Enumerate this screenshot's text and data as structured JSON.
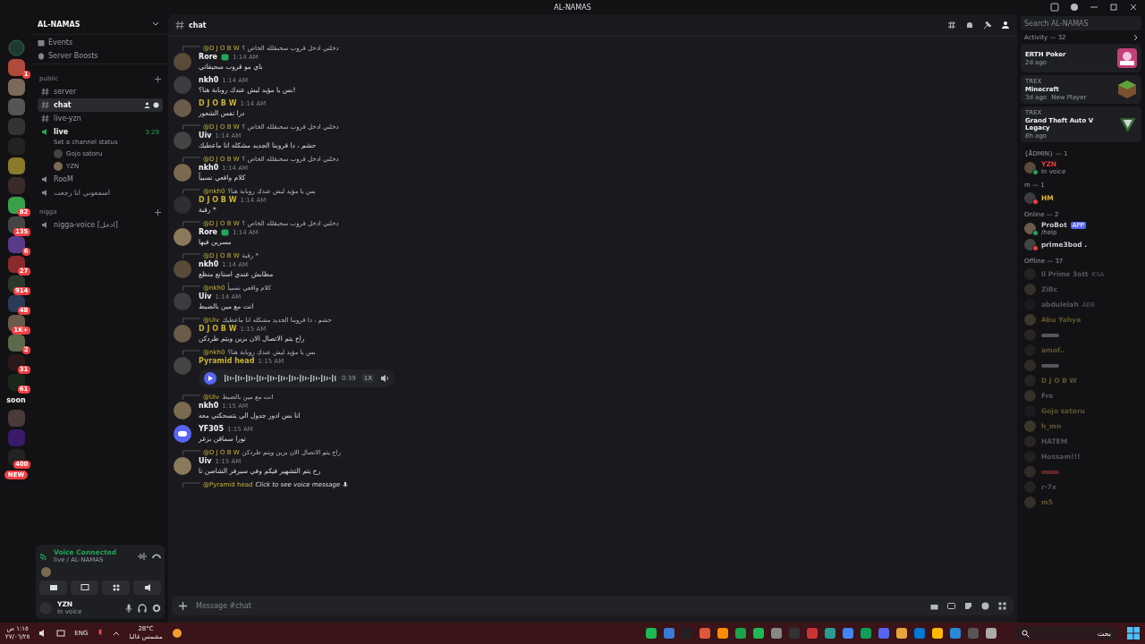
{
  "window": {
    "title": "AL-NAMAS"
  },
  "servers": [
    {
      "kind": "home"
    },
    {
      "kind": "server",
      "badge": "1"
    },
    {
      "kind": "server"
    },
    {
      "kind": "server"
    },
    {
      "kind": "server"
    },
    {
      "kind": "server"
    },
    {
      "kind": "server"
    },
    {
      "kind": "server"
    },
    {
      "kind": "server",
      "badge": "82"
    },
    {
      "kind": "server",
      "badge": "135"
    },
    {
      "kind": "server",
      "badge": "6"
    },
    {
      "kind": "server",
      "badge": "27"
    },
    {
      "kind": "server",
      "badge": "914"
    },
    {
      "kind": "server",
      "badge": "48"
    },
    {
      "kind": "server",
      "badge": "1K+"
    },
    {
      "kind": "server",
      "badge": "2"
    },
    {
      "kind": "server",
      "badge": "31"
    },
    {
      "kind": "server",
      "badge": "61"
    },
    {
      "kind": "label",
      "text": "soon"
    },
    {
      "kind": "server"
    },
    {
      "kind": "server"
    },
    {
      "kind": "server",
      "badge": "400"
    },
    {
      "kind": "new",
      "text": "NEW"
    }
  ],
  "sidebar": {
    "server_name": "AL-NAMAS",
    "links": [
      {
        "kind": "events",
        "label": "Events"
      },
      {
        "kind": "boosts",
        "label": "Server Boosts"
      }
    ],
    "categories": [
      {
        "name": "public",
        "channels": [
          {
            "kind": "text",
            "name": "server",
            "selected": false
          },
          {
            "kind": "text",
            "name": "chat",
            "selected": true
          },
          {
            "kind": "text",
            "name": "live-yzn",
            "selected": false
          },
          {
            "kind": "voice",
            "name": "live",
            "selected": false,
            "timer": "3:29",
            "status": "Set a channel status",
            "members": [
              "Gojo satoru",
              "YZN"
            ]
          },
          {
            "kind": "voice",
            "name": "RooM",
            "selected": false
          },
          {
            "kind": "voice",
            "name": "اسمعوني انا رجعت",
            "selected": false
          }
        ]
      },
      {
        "name": "nigga",
        "channels": [
          {
            "kind": "voice",
            "name": "nigga-voice [ادخل]",
            "selected": false
          }
        ]
      }
    ]
  },
  "voice": {
    "title": "Voice Connected",
    "subtitle": "live / AL-NAMAS"
  },
  "user": {
    "name": "YZN",
    "status": "In voice"
  },
  "chat": {
    "channel": "chat",
    "search_placeholder": "Search AL-NAMAS",
    "composer_placeholder": "Message #chat",
    "messages": [
      {
        "kind": "text",
        "reply_to": "@D J O B W",
        "reply_text": "دخلني ادخل قروب سحبقلله الخاص ؟",
        "author": "Rore",
        "color": "#f2f3f5",
        "verified": true,
        "time": "1:14 AM",
        "text": "باي مو قروب سحيقاتي"
      },
      {
        "kind": "text",
        "author": "nkh0",
        "color": "#f2f3f5",
        "verified": false,
        "time": "1:14 AM",
        "text": "بس يا مؤيد ليش عندك روبابة هنا؟!"
      },
      {
        "kind": "text",
        "author": "D J O B W",
        "color": "#c9b037",
        "verified": false,
        "time": "1:14 AM",
        "text": "درا نفس الشعور"
      },
      {
        "kind": "text",
        "reply_to": "@D J O B W",
        "reply_text": "دخلني ادخل قروب سحبقلله الخاص ؟",
        "author": "Uiv",
        "color": "#f2f3f5",
        "verified": false,
        "time": "1:14 AM",
        "text": "حشم ، دا قروبنا الجديد مشكله انا ماعطيك"
      },
      {
        "kind": "text",
        "reply_to": "@D J O B W",
        "reply_text": "دخلني ادخل قروب سحبقلله الخاص ؟",
        "author": "nkh0",
        "color": "#f2f3f5",
        "verified": false,
        "time": "1:14 AM",
        "text": "كلام واقعي نسبياً"
      },
      {
        "kind": "text",
        "reply_to": "@nkh0",
        "reply_text": "بس يا مؤيد ليش عندك روبابة هنا؟",
        "author": "D J O B W",
        "color": "#c9b037",
        "verified": false,
        "time": "1:14 AM",
        "text": "رقبة *"
      },
      {
        "kind": "text",
        "reply_to": "@D J O B W",
        "reply_text": "دخلني ادخل قروب سحبقلله الخاص ؟",
        "author": "Rore",
        "color": "#f2f3f5",
        "verified": true,
        "time": "1:14 AM",
        "text": "مسرين فيها"
      },
      {
        "kind": "text",
        "reply_to": "@D J O B W",
        "reply_text": "رقبة *",
        "author": "nkh0",
        "color": "#f2f3f5",
        "verified": false,
        "time": "1:14 AM",
        "text": "مطابش عندي اسنانع منظع"
      },
      {
        "kind": "text",
        "reply_to": "@nkh0",
        "reply_text": "كلام واقعي نسبياً",
        "author": "Uiv",
        "color": "#f2f3f5",
        "verified": false,
        "time": "1:14 AM",
        "text": "انت مع مين بالضبط"
      },
      {
        "kind": "text",
        "reply_to": "@Uiv",
        "reply_text": "حشم ، دا قروبنا الجديد مشكله انا ماعطيك",
        "author": "D J O B W",
        "color": "#c9b037",
        "verified": false,
        "time": "1:15 AM",
        "text": "راح يتم الاتصال الان بزين ويتم طردكن"
      },
      {
        "kind": "voice",
        "reply_to": "@nkh0",
        "reply_text": "بس يا مؤيد ليش عندك روبابة هنا؟",
        "author": "Pyramid head",
        "color": "#c9b037",
        "verified": false,
        "time": "1:15 AM",
        "duration": "0:39",
        "speed": "1X"
      },
      {
        "kind": "text",
        "reply_to": "@Uiv",
        "reply_text": "انت مع مين بالضبط",
        "author": "nkh0",
        "color": "#f2f3f5",
        "verified": false,
        "time": "1:15 AM",
        "text": "انا بس ادور جدول الي يتسحكني معه"
      },
      {
        "kind": "text",
        "author": "YF305",
        "color": "#f2f3f5",
        "verified": false,
        "time": "1:15 AM",
        "text": "نورا سماقن بزغر"
      },
      {
        "kind": "text",
        "reply_to": "@D J O B W",
        "reply_text": "راح يتم الاتصال الان بزين ويتم طردكن",
        "author": "Uiv",
        "color": "#f2f3f5",
        "verified": false,
        "time": "1:15 AM",
        "text": "رح يتم التشهير فيكم وفي سيرفر الشاصن نا"
      },
      {
        "kind": "cut",
        "reply_to": "@Pyramid head",
        "reply_text": "Click to see voice message"
      }
    ]
  },
  "members": {
    "activity_title": "Activity — 32",
    "cards": [
      {
        "kind": "poker",
        "game": "ERTH Poker",
        "meta": "2d ago"
      },
      {
        "kind": "minecraft",
        "user": "TREX",
        "game": "Minecraft",
        "meta": "3d ago",
        "tag": "New Player"
      },
      {
        "kind": "gta",
        "user": "TREX",
        "game": "Grand Theft Auto V Legacy",
        "meta": "8h ago"
      }
    ],
    "groups": [
      {
        "title": "{ÅDMIN} — 1",
        "kind": "online",
        "members": [
          {
            "name": "YZN",
            "color": "#e03a3a",
            "dnd": false,
            "status": "In voice"
          }
        ]
      },
      {
        "title": "m — 1",
        "kind": "online",
        "members": [
          {
            "name": "HM",
            "color": "#e3b43a",
            "dnd": true
          }
        ]
      },
      {
        "title": "Online — 2",
        "kind": "online",
        "members": [
          {
            "name": "ProBot",
            "color": "#c9ccd1",
            "dnd": false,
            "status": "/help",
            "app": "APP"
          },
          {
            "name": "prime3bod .",
            "color": "#c9ccd1",
            "dnd": true
          }
        ]
      },
      {
        "title": "Offline — 37",
        "kind": "offline",
        "members": [
          {
            "name": "ll Prime 3ott",
            "color": "#55575e",
            "tag": "KSA"
          },
          {
            "name": "ZiBc",
            "color": "#55575e"
          },
          {
            "name": "abdulelah",
            "color": "#55575e",
            "tag": "ABB"
          },
          {
            "name": "Abu Yahya",
            "color": "#5e5530"
          },
          {
            "color": "#55575e"
          },
          {
            "name": "amof..",
            "color": "#5e5530"
          },
          {
            "color": "#55575e"
          },
          {
            "name": "D J O B W",
            "color": "#5e5530"
          },
          {
            "name": "Fro",
            "color": "#55575e"
          },
          {
            "name": "Gojo satoru",
            "color": "#5e5530"
          },
          {
            "name": "h_mn",
            "color": "#5e5530"
          },
          {
            "name": "HATEM",
            "color": "#55575e"
          },
          {
            "name": "Hossam!!!",
            "color": "#55575e"
          },
          {
            "color": "#5e2626"
          },
          {
            "name": "r-7x",
            "color": "#55575e"
          },
          {
            "name": "m5",
            "color": "#5e5530"
          }
        ]
      }
    ]
  },
  "taskbar": {
    "time": "١:١٥ ص",
    "date": "٢٧/٠٦/٢٥",
    "lang": "ENG",
    "temperature": "28°C",
    "weather": "مشمس غالبا",
    "search_placeholder": "بحث"
  }
}
